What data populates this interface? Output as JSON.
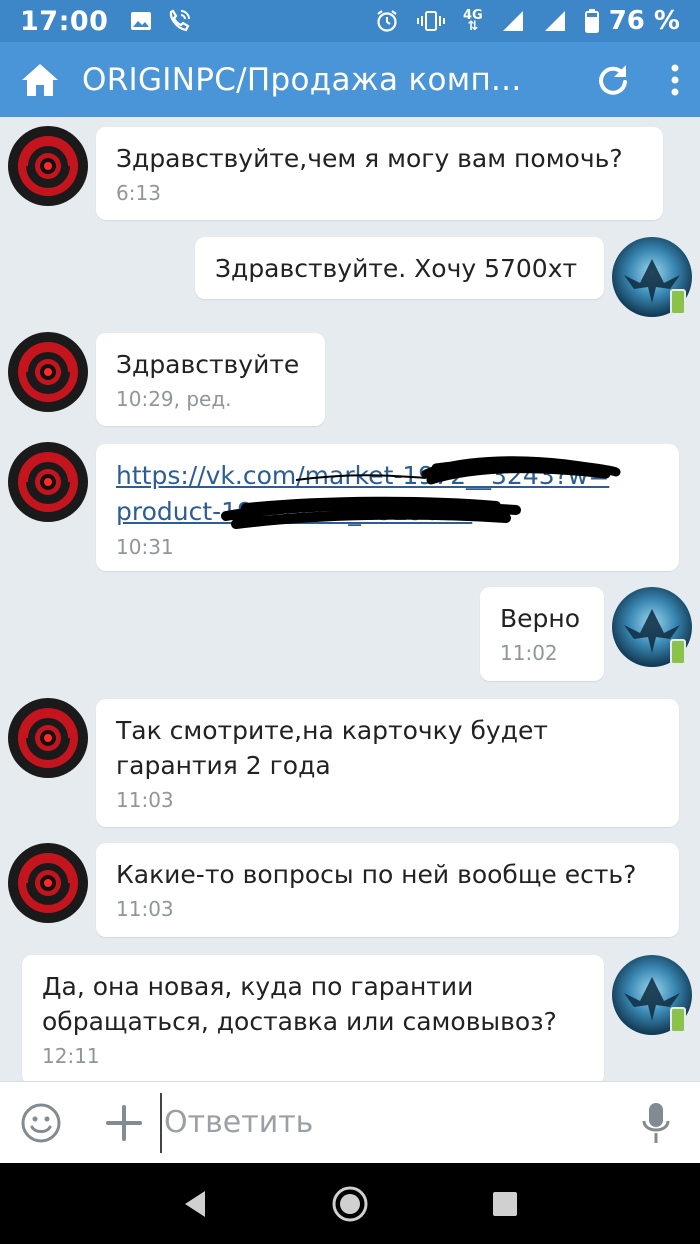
{
  "status_bar": {
    "time": "17:00",
    "network_label": "4G",
    "battery_percent": "76 %",
    "battery_level": 0.76,
    "icons": [
      "image-icon",
      "wifi-call-icon",
      "alarm-icon",
      "vibrate-icon",
      "signal-icon",
      "signal-icon",
      "battery-icon"
    ]
  },
  "header": {
    "title": "ORIGINPC/Продажа комп...",
    "home_icon": "home-icon",
    "refresh_icon": "refresh-icon",
    "menu_icon": "more-vert-icon",
    "color": "#4a95d8"
  },
  "messages": [
    {
      "side": "incoming",
      "text": "Здравствуйте,чем я могу вам помочь?",
      "time": "6:13"
    },
    {
      "side": "outgoing",
      "text": "Здравствуйте. Хочу 5700хт",
      "time": ""
    },
    {
      "side": "incoming",
      "text": "Здравствуйте",
      "time": "10:29, ред."
    },
    {
      "side": "incoming",
      "link_line1": "https://vk.com/market-1972__3243?w=",
      "link_line2": "product-19720000_4329082",
      "time": "10:31"
    },
    {
      "side": "outgoing",
      "text": "Верно",
      "time": "11:02"
    },
    {
      "side": "incoming",
      "text_line1": "Так смотрите,на карточку будет",
      "text_line2": "гарантия 2 года",
      "time": "11:03"
    },
    {
      "side": "incoming",
      "text": "Какие-то вопросы по ней вообще есть?",
      "time": "11:03"
    },
    {
      "side": "outgoing",
      "text_line1": "Да, она новая, куда по гарантии",
      "text_line2": "обращаться, доставка или самовывоз?",
      "time": "12:11"
    }
  ],
  "input": {
    "placeholder": "Ответить",
    "emoji_icon": "emoji-icon",
    "attach_icon": "plus-icon",
    "mic_icon": "microphone-icon"
  },
  "nav_bar": {
    "icons": [
      "back-icon",
      "home-circle-icon",
      "recents-icon"
    ]
  }
}
